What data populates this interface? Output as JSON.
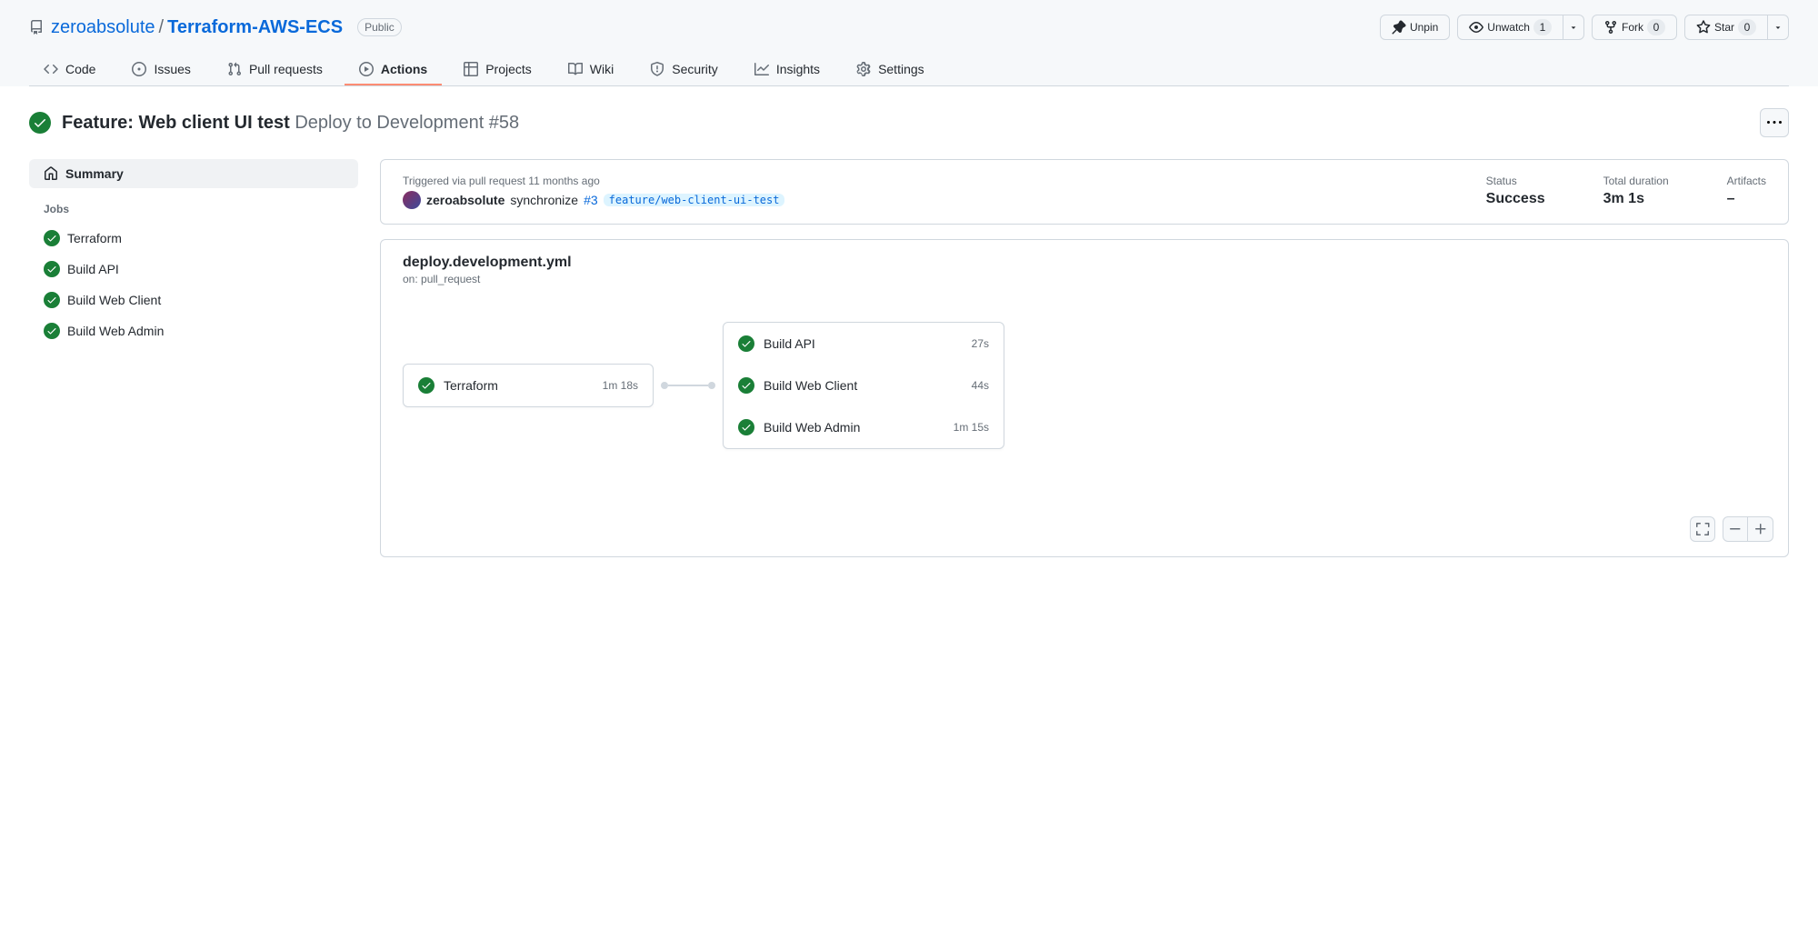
{
  "repo": {
    "owner": "zeroabsolute",
    "name": "Terraform-AWS-ECS",
    "visibility": "Public"
  },
  "header_actions": {
    "unpin": "Unpin",
    "unwatch": "Unwatch",
    "unwatch_count": "1",
    "fork": "Fork",
    "fork_count": "0",
    "star": "Star",
    "star_count": "0"
  },
  "tabs": {
    "code": "Code",
    "issues": "Issues",
    "pulls": "Pull requests",
    "actions": "Actions",
    "projects": "Projects",
    "wiki": "Wiki",
    "security": "Security",
    "insights": "Insights",
    "settings": "Settings"
  },
  "run": {
    "commit_message": "Feature: Web client UI test",
    "workflow_run_name": "Deploy to Development #58",
    "trigger_label": "Triggered via pull request 11 months ago",
    "actor": "zeroabsolute",
    "event": "synchronize",
    "pr_number": "#3",
    "branch": "feature/web-client-ui-test",
    "status_label": "Status",
    "status_value": "Success",
    "duration_label": "Total duration",
    "duration_value": "3m 1s",
    "artifacts_label": "Artifacts",
    "artifacts_value": "–"
  },
  "sidebar": {
    "summary": "Summary",
    "jobs_label": "Jobs",
    "jobs": [
      {
        "name": "Terraform"
      },
      {
        "name": "Build API"
      },
      {
        "name": "Build Web Client"
      },
      {
        "name": "Build Web Admin"
      }
    ]
  },
  "graph": {
    "workflow_file": "deploy.development.yml",
    "on_event": "on: pull_request",
    "job_stage1": {
      "name": "Terraform",
      "duration": "1m 18s"
    },
    "job_stage2": [
      {
        "name": "Build API",
        "duration": "27s"
      },
      {
        "name": "Build Web Client",
        "duration": "44s"
      },
      {
        "name": "Build Web Admin",
        "duration": "1m 15s"
      }
    ]
  }
}
